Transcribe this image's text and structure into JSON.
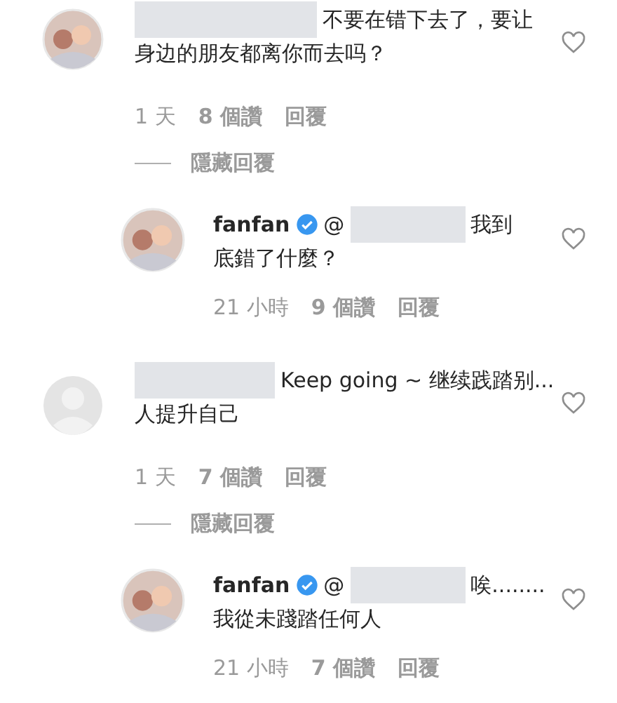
{
  "comments": [
    {
      "avatar": {
        "kind": "photo"
      },
      "author_redacted": true,
      "lines": [
        "不要在错下去了，要让",
        "身边的朋友都离你而去吗？"
      ],
      "time": "1 天",
      "likes": "8 個讚",
      "reply": "回覆",
      "hide_replies": "隱藏回覆",
      "replies": [
        {
          "avatar": {
            "kind": "photo"
          },
          "author": "fanfan",
          "verified": true,
          "mention": "@",
          "lines": [
            "我到",
            "底錯了什麼？"
          ],
          "time": "21 小時",
          "likes": "9 個讚",
          "reply": "回覆"
        }
      ]
    },
    {
      "avatar": {
        "kind": "blank"
      },
      "author_redacted": true,
      "lines": [
        "Keep going ~ 继续践踏别...",
        "人提升自己"
      ],
      "time": "1 天",
      "likes": "7 個讚",
      "reply": "回覆",
      "hide_replies": "隱藏回覆",
      "replies": [
        {
          "avatar": {
            "kind": "photo"
          },
          "author": "fanfan",
          "verified": true,
          "mention": "@",
          "lines": [
            "唉........",
            "我從未踐踏任何人"
          ],
          "time": "21 小時",
          "likes": "7 個讚",
          "reply": "回覆"
        }
      ]
    }
  ]
}
